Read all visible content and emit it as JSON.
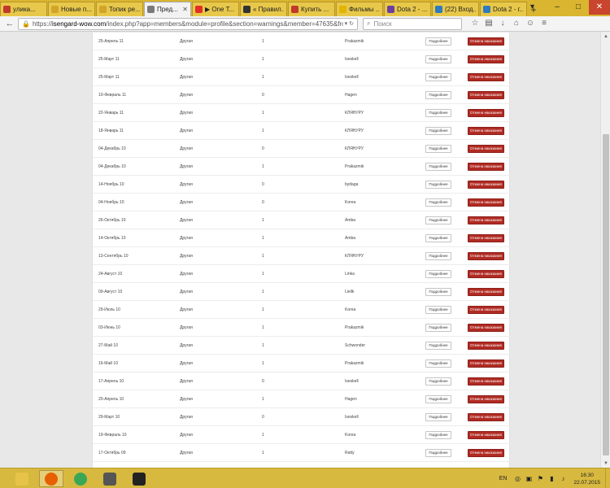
{
  "browser": {
    "tabs": [
      {
        "label": "улика...",
        "color": "#c0392b",
        "active": false
      },
      {
        "label": "Новые п...",
        "color": "#d2a42a",
        "active": false
      },
      {
        "label": "Топик ре...",
        "color": "#d2a42a",
        "active": false
      },
      {
        "label": "Пред...",
        "color": "#7a7a7a",
        "active": true
      },
      {
        "label": "▶ One T...",
        "color": "#e52d27",
        "active": false
      },
      {
        "label": "« Правил...",
        "color": "#333333",
        "active": false
      },
      {
        "label": "Купить ...",
        "color": "#c0392b",
        "active": false
      },
      {
        "label": "Фильмы ...",
        "color": "#e0b400",
        "active": false
      },
      {
        "label": "Dota 2 - ...",
        "color": "#6b3fa0",
        "active": false
      },
      {
        "label": "(22) Вход...",
        "color": "#2e7bbf",
        "active": false
      },
      {
        "label": "Dota 2 - г...",
        "color": "#2e7bbf",
        "active": false
      }
    ],
    "url_prefix": "https://",
    "url_domain": "isengard-wow.com",
    "url_path": "/index.php?app=members&module=profile&section=warnings&member=47635&from_app=memb",
    "search_placeholder": "Поиск"
  },
  "table": {
    "details_label": "Подробнее",
    "cancel_label": "Отмена наказания",
    "rows": [
      {
        "date": "25-Апрель 11",
        "type": "Другая",
        "points": "1",
        "moderator": "Prakazmik"
      },
      {
        "date": "25-Март 11",
        "type": "Другая",
        "points": "1",
        "moderator": "Iseskell"
      },
      {
        "date": "25-Март 11",
        "type": "Другая",
        "points": "1",
        "moderator": "Iseskell"
      },
      {
        "date": "10-Февраль 11",
        "type": "Другая",
        "points": "0",
        "moderator": "Hagen"
      },
      {
        "date": "22-Январь 11",
        "type": "Другая",
        "points": "1",
        "moderator": "КЛЯНУРУ"
      },
      {
        "date": "18-Январь 11",
        "type": "Другая",
        "points": "1",
        "moderator": "КЛЯНУРУ"
      },
      {
        "date": "04-Декабрь 10",
        "type": "Другая",
        "points": "0",
        "moderator": "КЛЯНУРУ"
      },
      {
        "date": "04-Декабрь 10",
        "type": "Другая",
        "points": "1",
        "moderator": "Prakazmik"
      },
      {
        "date": "14-Ноябрь 10",
        "type": "Другая",
        "points": "0",
        "moderator": "bydaga"
      },
      {
        "date": "04-Ноябрь 10",
        "type": "Другая",
        "points": "0",
        "moderator": "Korea"
      },
      {
        "date": "26-Октябрь 10",
        "type": "Другая",
        "points": "1",
        "moderator": "Amba"
      },
      {
        "date": "14-Октябрь 10",
        "type": "Другая",
        "points": "1",
        "moderator": "Amba"
      },
      {
        "date": "13-Сентябрь 10",
        "type": "Другая",
        "points": "1",
        "moderator": "КЛЯНУРУ"
      },
      {
        "date": "24-Август 10",
        "type": "Другая",
        "points": "1",
        "moderator": "Linka"
      },
      {
        "date": "09-Август 10",
        "type": "Другая",
        "points": "1",
        "moderator": "Liellk"
      },
      {
        "date": "29-Июль 10",
        "type": "Другая",
        "points": "1",
        "moderator": "Korea"
      },
      {
        "date": "03-Июнь 10",
        "type": "Другая",
        "points": "1",
        "moderator": "Prakazmik"
      },
      {
        "date": "27-Май 10",
        "type": "Другая",
        "points": "1",
        "moderator": "Schwonder"
      },
      {
        "date": "16-Май 10",
        "type": "Другая",
        "points": "1",
        "moderator": "Prakazmik"
      },
      {
        "date": "17-Апрель 10",
        "type": "Другая",
        "points": "0",
        "moderator": "Iseskell"
      },
      {
        "date": "20-Апрель 10",
        "type": "Другая",
        "points": "1",
        "moderator": "Hagen"
      },
      {
        "date": "29-Март 10",
        "type": "Другая",
        "points": "0",
        "moderator": "Iseskell"
      },
      {
        "date": "19-Февраль 10",
        "type": "Другая",
        "points": "1",
        "moderator": "Korea"
      },
      {
        "date": "17-Октябрь 09",
        "type": "Другая",
        "points": "1",
        "moderator": "Ratty"
      }
    ]
  },
  "taskbar": {
    "apps": [
      {
        "name": "file-explorer-icon",
        "color": "#e7c34a",
        "active": false
      },
      {
        "name": "firefox-icon",
        "color": "#e66000",
        "active": true
      },
      {
        "name": "chrome-icon",
        "color": "#3aa757",
        "active": false
      },
      {
        "name": "calendar-app-icon",
        "color": "#555555",
        "active": false
      },
      {
        "name": "game-launcher-icon",
        "color": "#222222",
        "active": false
      }
    ],
    "lang": "EN",
    "time": "16:30",
    "date": "22.07.2015"
  }
}
